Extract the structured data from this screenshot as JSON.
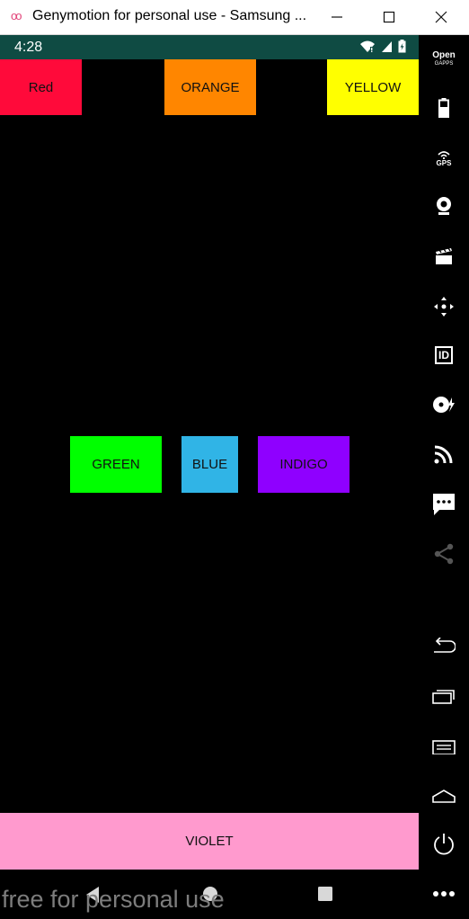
{
  "window": {
    "title": "Genymotion for personal use - Samsung ...",
    "logo_glyph": "oo",
    "controls": [
      "minimize-icon",
      "maximize-icon",
      "close-icon"
    ]
  },
  "statusbar": {
    "time": "4:28",
    "icons": [
      "wifi-icon",
      "signal-icon",
      "battery-icon"
    ],
    "background": "#0f4b43"
  },
  "buttons": {
    "red": {
      "label": "Red",
      "color": "#ff0a3a"
    },
    "orange": {
      "label": "ORANGE",
      "color": "#ff8600"
    },
    "yellow": {
      "label": "YELLOW",
      "color": "#ffff00"
    },
    "green": {
      "label": "GREEN",
      "color": "#00ff00"
    },
    "blue": {
      "label": "BLUE",
      "color": "#30b4e6"
    },
    "indigo": {
      "label": "INDIGO",
      "color": "#8f00ff"
    },
    "violet": {
      "label": "VIOLET",
      "color": "#ff9ace"
    }
  },
  "navbar": {
    "icons": [
      "back-icon",
      "home-icon",
      "recents-icon"
    ]
  },
  "watermark": "free for personal use",
  "sidebar": {
    "open_gapps": {
      "line1": "Open",
      "line2": "GAPPS"
    },
    "gps_label": "GPS",
    "id_label": "ID",
    "items": [
      "open-gapps-icon",
      "battery-icon",
      "gps-icon",
      "webcam-icon",
      "media-icon",
      "dpad-icon",
      "id-icon",
      "disk-io-icon",
      "cast-icon",
      "sms-icon",
      "share-icon",
      "back-icon",
      "recents-icon",
      "menu-icon",
      "home-icon",
      "power-icon",
      "more-icon"
    ]
  }
}
